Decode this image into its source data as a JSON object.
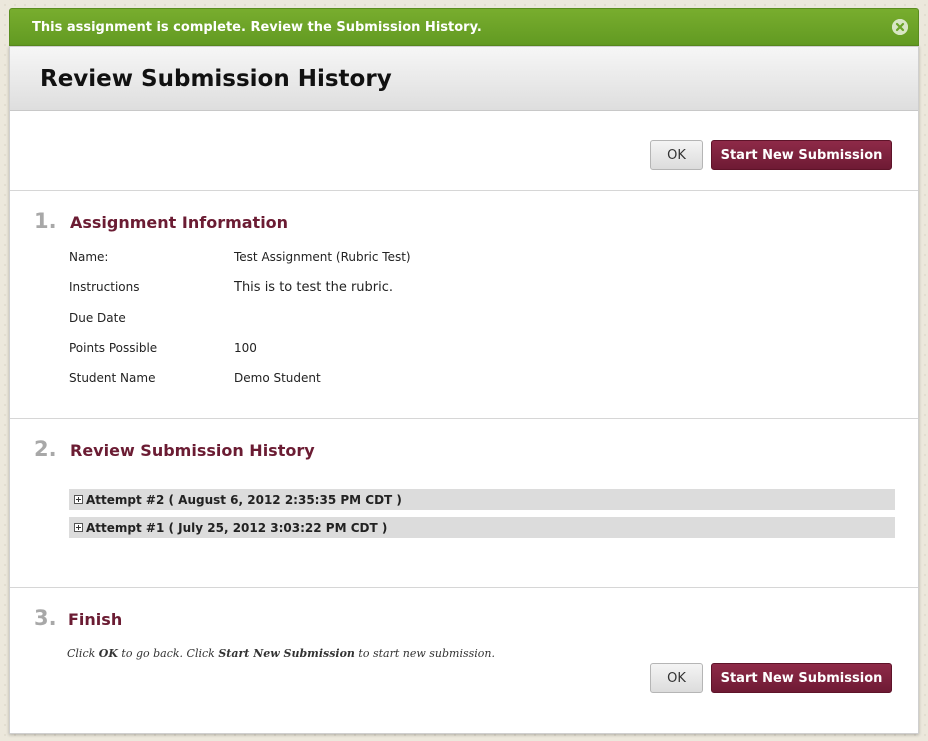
{
  "alert": {
    "message": "This assignment is complete. Review the Submission History.",
    "close_icon": "close-circle-icon"
  },
  "page": {
    "title": "Review Submission History"
  },
  "buttons": {
    "ok_label": "OK",
    "start_new_label": "Start New Submission"
  },
  "steps": [
    {
      "number": "1.",
      "title": "Assignment Information"
    },
    {
      "number": "2.",
      "title": "Review Submission History"
    },
    {
      "number": "3.",
      "title": "Finish"
    }
  ],
  "assignment_info": [
    {
      "label": "Name:",
      "value": "Test Assignment (Rubric Test)"
    },
    {
      "label": "Instructions",
      "value": "This is to test the rubric."
    },
    {
      "label": "Due Date",
      "value": ""
    },
    {
      "label": "Points Possible",
      "value": "100"
    },
    {
      "label": "Student Name",
      "value": "Demo Student"
    }
  ],
  "attempts": [
    {
      "label": "Attempt #2 ( August 6, 2012 2:35:35 PM CDT )"
    },
    {
      "label": "Attempt #1 ( July 25, 2012 3:03:22 PM CDT )"
    }
  ],
  "finish": {
    "text_1": "Click ",
    "text_ok": "OK",
    "text_2": " to go back. Click ",
    "text_start": "Start New Submission",
    "text_3": " to start new submission."
  },
  "colors": {
    "alert_green": "#6ba427",
    "accent_maroon": "#6b1c33",
    "primary_button": "#7e2140"
  }
}
